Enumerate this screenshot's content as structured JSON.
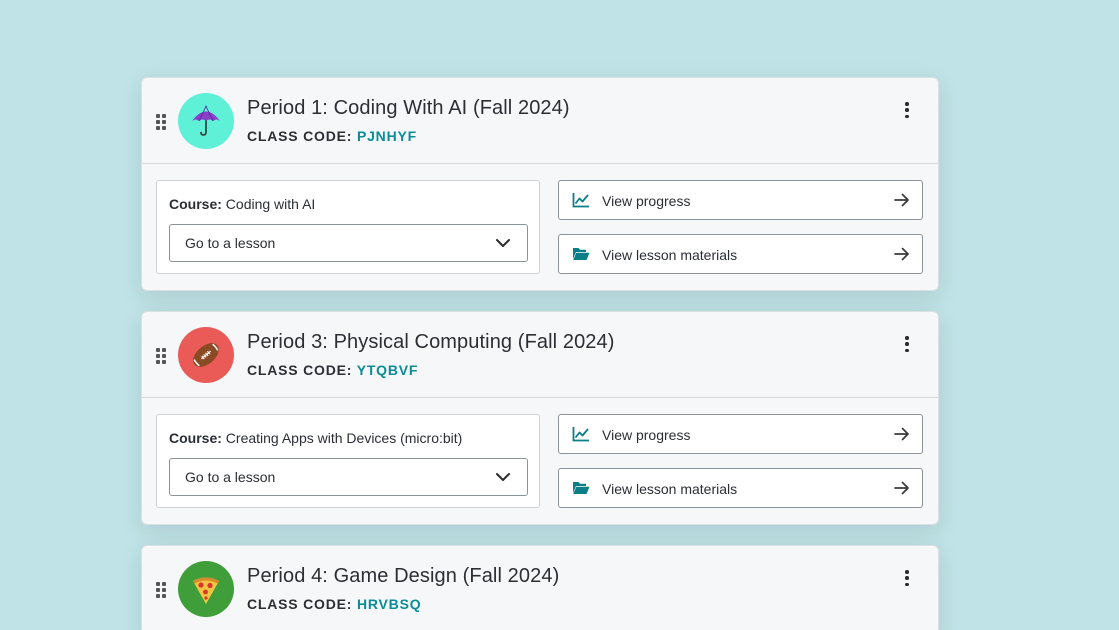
{
  "colors": {
    "background": "#bfe3e6",
    "accent": "#0a8c96",
    "card": "#f6f7f9"
  },
  "common": {
    "class_code_label": "CLASS CODE:",
    "course_label": "Course:",
    "lesson_select_value": "Go to a lesson",
    "view_progress_label": "View progress",
    "view_materials_label": "View lesson materials"
  },
  "sections": [
    {
      "title": "Period 1: Coding With AI (Fall 2024)",
      "class_code": "PJNHYF",
      "course": "Coding with AI",
      "avatar_icon": "umbrella-icon",
      "avatar_color": "#5ff0d8"
    },
    {
      "title": "Period 3: Physical Computing (Fall 2024)",
      "class_code": "YTQBVF",
      "course": "Creating Apps with Devices (micro:bit)",
      "avatar_icon": "football-icon",
      "avatar_color": "#ea5b57"
    },
    {
      "title": "Period 4: Game Design (Fall 2024)",
      "class_code": "HRVBSQ",
      "avatar_icon": "pizza-icon",
      "avatar_color": "#3f9e3a"
    }
  ]
}
